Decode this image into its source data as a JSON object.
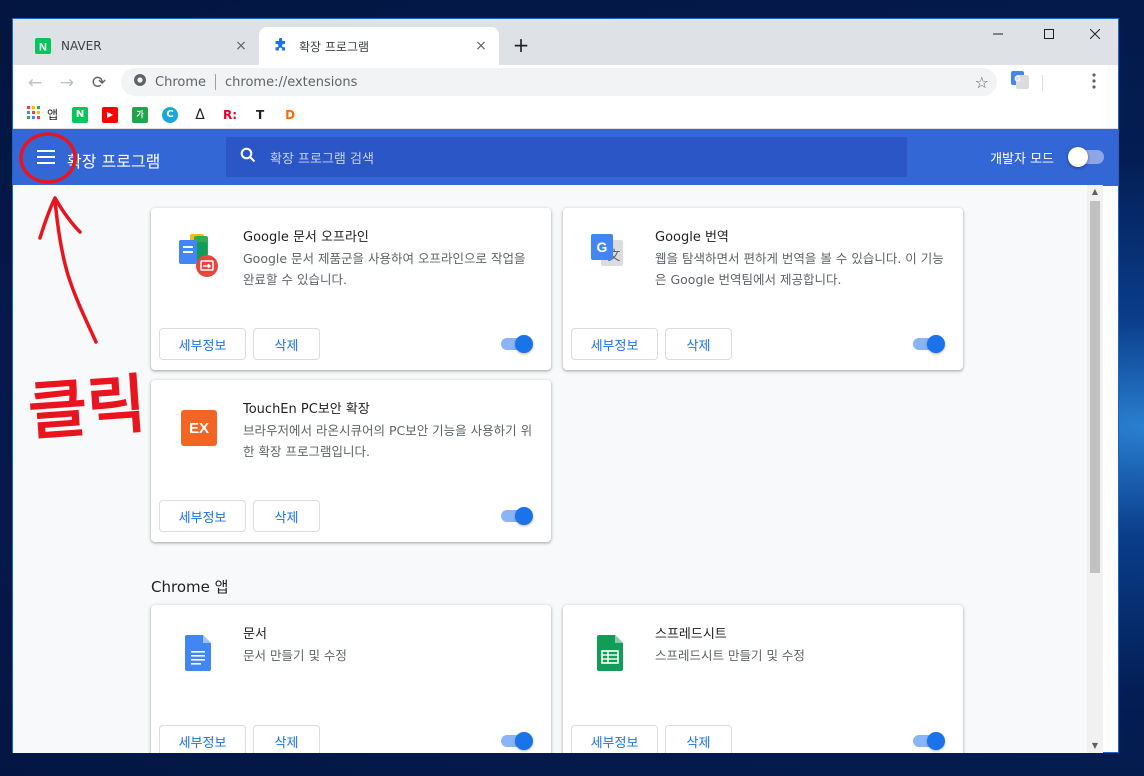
{
  "tabs": [
    {
      "title": "NAVER",
      "close": "×",
      "favicon": "naver-icon"
    },
    {
      "title": "확장 프로그램",
      "close": "×",
      "favicon": "puzzle-icon"
    }
  ],
  "new_tab": "+",
  "omnibox": {
    "chip": "Chrome",
    "url": "chrome://extensions"
  },
  "bookmarks": [
    {
      "label": "앱",
      "icon": "apps-grid-icon"
    },
    {
      "label": "",
      "icon": "naver-icon",
      "color": "#03c75a",
      "glyph": "N"
    },
    {
      "label": "",
      "icon": "youtube-icon",
      "color": "#ff0000",
      "glyph": "▶"
    },
    {
      "label": "",
      "icon": "bookmark-ga-icon",
      "color": "#1fa64a",
      "glyph": "가"
    },
    {
      "label": "",
      "icon": "bookmark-cyan-icon",
      "color": "#19a7d9",
      "glyph": "C"
    },
    {
      "label": "",
      "icon": "delta-icon",
      "color": "#202124",
      "glyph": "Δ"
    },
    {
      "label": "",
      "icon": "bookmark-r-icon",
      "color": "#e0002a",
      "glyph": "R:"
    },
    {
      "label": "",
      "icon": "bookmark-t-icon",
      "color": "#202124",
      "glyph": "T"
    },
    {
      "label": "",
      "icon": "bookmark-d-icon",
      "color": "#ff6a00",
      "glyph": "D"
    }
  ],
  "header": {
    "title": "확장 프로그램",
    "search_placeholder": "확장 프로그램 검색",
    "dev_mode_label": "개발자 모드",
    "dev_mode_on": false
  },
  "extensions": [
    {
      "name": "Google 문서 오프라인",
      "desc": "Google 문서 제품군을 사용하여 오프라인으로 작업을 완료할 수 있습니다.",
      "details": "세부정보",
      "remove": "삭제",
      "enabled": true,
      "icon": "google-docs-offline-icon"
    },
    {
      "name": "Google 번역",
      "desc": "웹을 탐색하면서 편하게 번역을 볼 수 있습니다. 이 기능은 Google 번역팀에서 제공합니다.",
      "details": "세부정보",
      "remove": "삭제",
      "enabled": true,
      "icon": "google-translate-icon"
    },
    {
      "name": "TouchEn PC보안 확장",
      "desc": "브라우저에서 라온시큐어의 PC보안 기능을 사용하기 위한 확장 프로그램입니다.",
      "details": "세부정보",
      "remove": "삭제",
      "enabled": true,
      "icon": "touchen-ex-icon",
      "glyph": "EX"
    }
  ],
  "apps_section_title": "Chrome 앱",
  "apps": [
    {
      "name": "문서",
      "desc": "문서 만들기 및 수정",
      "details": "세부정보",
      "remove": "삭제",
      "enabled": true,
      "icon": "google-docs-icon"
    },
    {
      "name": "스프레드시트",
      "desc": "스프레드시트 만들기 및 수정",
      "details": "세부정보",
      "remove": "삭제",
      "enabled": true,
      "icon": "google-sheets-icon"
    }
  ],
  "annotation": {
    "text": "클릭",
    "color": "#e8141e"
  },
  "colors": {
    "header_blue": "#3367d6",
    "accent": "#1a73e8"
  }
}
